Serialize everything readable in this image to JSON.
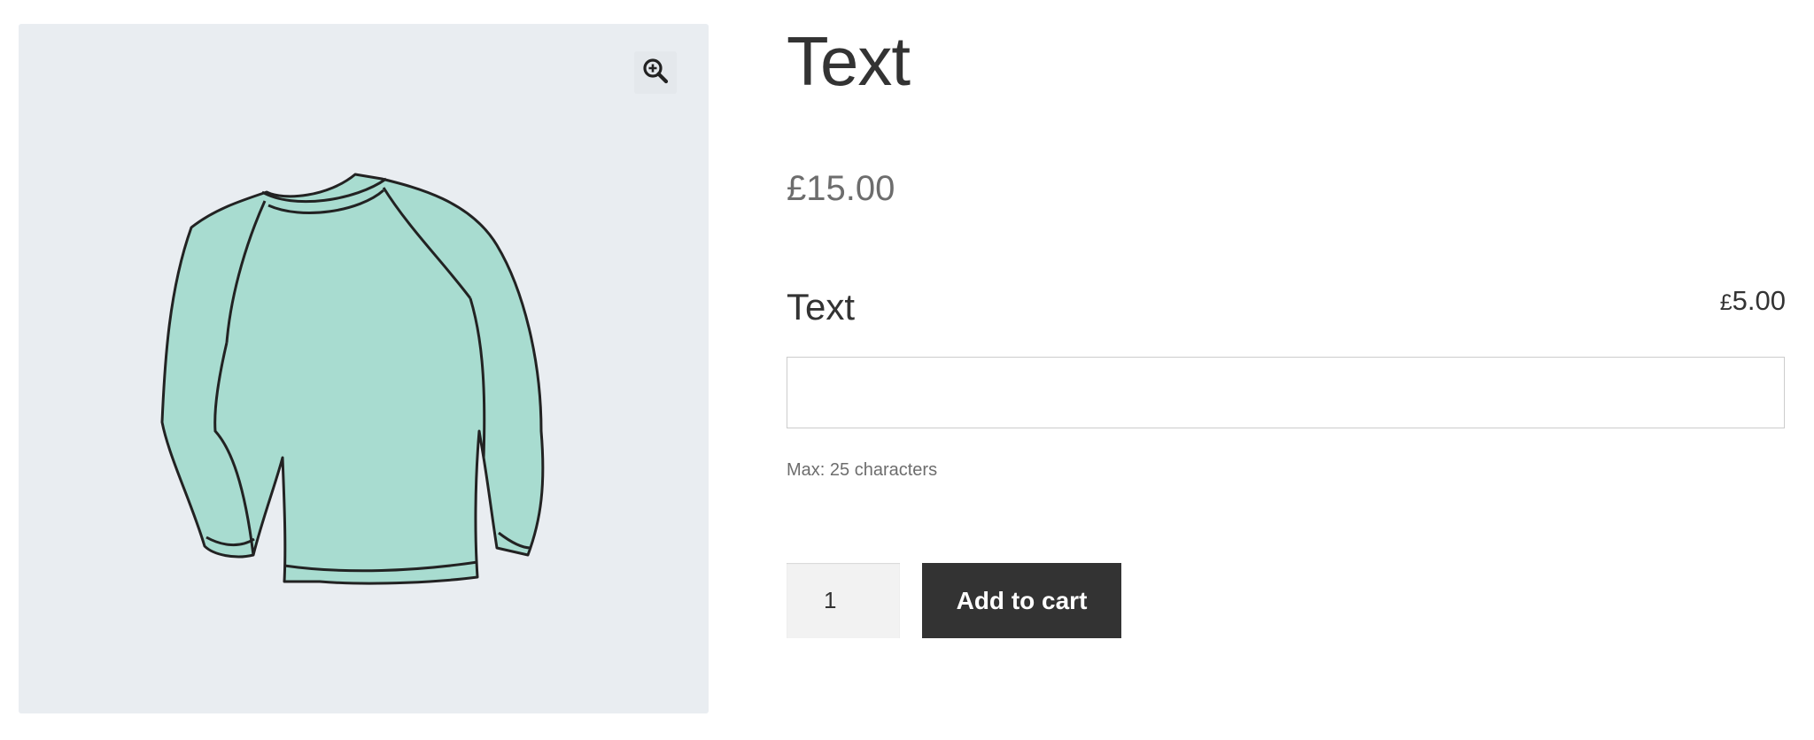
{
  "gallery": {
    "zoom_icon": "magnifier-plus-icon",
    "image": "long-sleeve-shirt-illustration",
    "background_color": "#e9edf1",
    "shirt_color": "#a8dcd0"
  },
  "product": {
    "title": "Text",
    "price": "£15.00"
  },
  "addon": {
    "label": "Text",
    "price_currency": "£",
    "price_amount": "5.00",
    "input_value": "",
    "hint": "Max: 25 characters"
  },
  "cart": {
    "quantity": "1",
    "add_to_cart_label": "Add to cart",
    "button_color": "#333333"
  }
}
